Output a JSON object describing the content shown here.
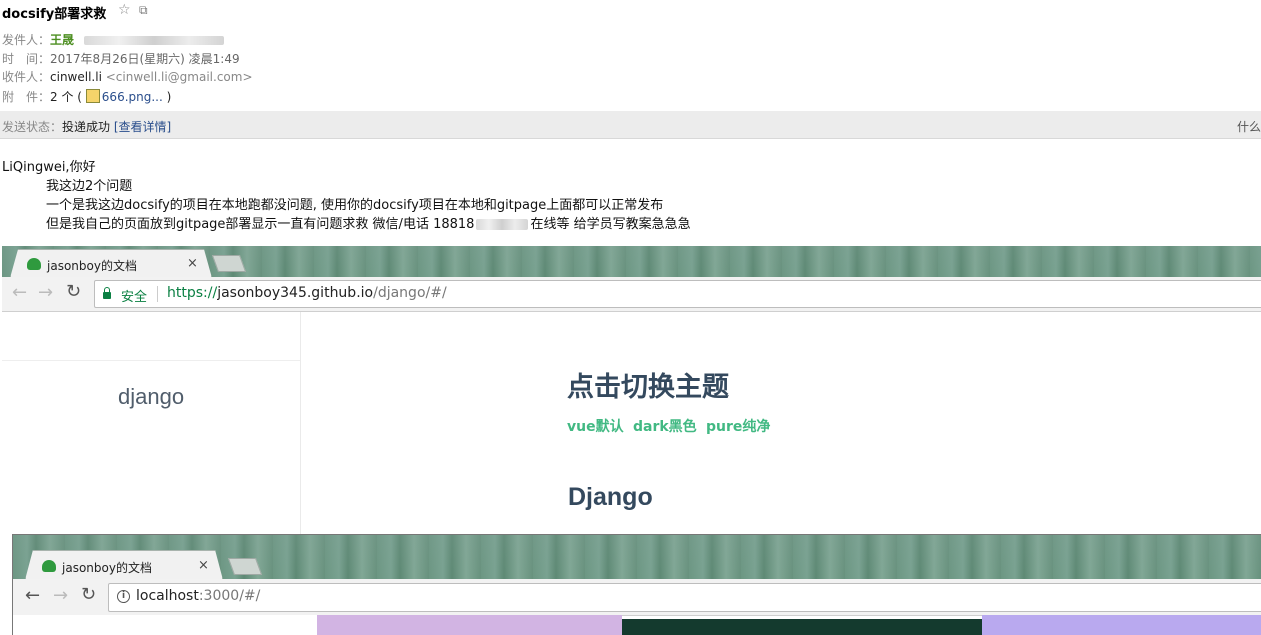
{
  "email": {
    "subject": "docsify部署求救",
    "star_icon": "star-icon",
    "popout_icon": "popout-icon",
    "from_label": "发件人：",
    "from_name": "王晟",
    "time_label": "时　间：",
    "time_value": "2017年8月26日(星期六) 凌晨1:49",
    "to_label": "收件人：",
    "to_name": "cinwell.li",
    "to_email": "<cinwell.li@gmail.com>",
    "attach_label": "附　件：",
    "attach_count": "2 个 (",
    "attach_file": "666.png...",
    "attach_close": ")",
    "status_label": "发送状态：",
    "status_value": "投递成功",
    "status_link": "[查看详情]",
    "status_right": "什么",
    "greeting": "LiQingwei,你好",
    "line1": "我这边2个问题",
    "line2": "一个是我这边docsify的项目在本地跑都没问题, 使用你的docsify项目在本地和gitpage上面都可以正常发布",
    "line3a": "但是我自己的页面放到gitpage部署显示一直有问题求救 微信/电话 18818",
    "line3b": "在线等 给学员写教案急急急"
  },
  "browser1": {
    "tab_title": "jasonboy的文档",
    "tab_close": "×",
    "secure_label": "安全",
    "url_scheme": "https://",
    "url_host": "jasonboy345.github.io",
    "url_path": "/django/#/",
    "sidebar_name": "django",
    "theme_title": "点击切换主题",
    "themes": [
      "vue默认",
      "dark黑色",
      "pure纯净"
    ],
    "heading": "Django",
    "colors": {
      "accent": "#42b983",
      "secure": "#0b8043"
    }
  },
  "browser2": {
    "tab_title": "jasonboy的文档",
    "tab_close": "×",
    "url_host": "localhost",
    "url_path": ":3000/#/",
    "colors": {
      "banner_left": "#d2b4e3",
      "banner_dark": "#143a2e",
      "banner_right": "#b9a9ef"
    }
  }
}
